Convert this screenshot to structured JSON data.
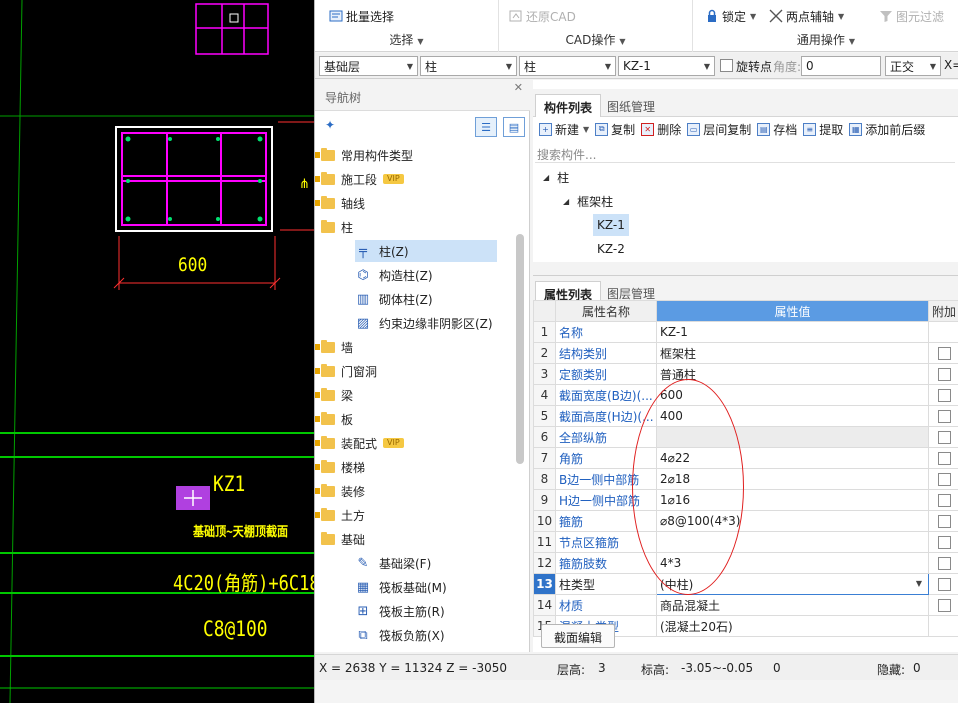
{
  "cad": {
    "dim_label": "600",
    "element_label": "KZ1",
    "note_label": "基础顶~天棚顶截面",
    "rebar_label": "4C20(角筋)+6C18",
    "stirrup_label": "C8@100"
  },
  "ribbon": {
    "groups": [
      {
        "label": "选择",
        "buttons": [
          {
            "label": "批量选择",
            "icon": "batch-select-icon"
          }
        ]
      },
      {
        "label": "CAD操作",
        "buttons": [
          {
            "label": "还原CAD",
            "icon": "restore-cad-icon",
            "disabled": true
          }
        ]
      },
      {
        "label": "通用操作",
        "buttons": [
          {
            "label": "锁定",
            "icon": "lock-icon"
          },
          {
            "label": "两点辅轴",
            "icon": "axis-icon"
          },
          {
            "label": "图元过滤",
            "icon": "filter-icon",
            "disabled": true
          }
        ]
      }
    ]
  },
  "selector": {
    "layer": "基础层",
    "category": "柱",
    "type": "柱",
    "component": "KZ-1",
    "rotate_label": "旋转点",
    "angle_label": "角度:",
    "angle_value": "0",
    "mode": "正交",
    "x_label": "X="
  },
  "nav": {
    "title": "导航树",
    "items": [
      {
        "label": "常用构件类型",
        "vip": false
      },
      {
        "label": "施工段",
        "vip": true
      },
      {
        "label": "轴线",
        "vip": false
      },
      {
        "label": "柱",
        "vip": false
      },
      {
        "label": "柱(Z)"
      },
      {
        "label": "构造柱(Z)"
      },
      {
        "label": "砌体柱(Z)"
      },
      {
        "label": "约束边缘非阴影区(Z)"
      },
      {
        "label": "墙",
        "vip": false
      },
      {
        "label": "门窗洞",
        "vip": false
      },
      {
        "label": "梁",
        "vip": false
      },
      {
        "label": "板",
        "vip": false
      },
      {
        "label": "装配式",
        "vip": true
      },
      {
        "label": "楼梯",
        "vip": false
      },
      {
        "label": "装修",
        "vip": false
      },
      {
        "label": "土方",
        "vip": false
      },
      {
        "label": "基础",
        "vip": false
      },
      {
        "label": "基础梁(F)"
      },
      {
        "label": "筏板基础(M)"
      },
      {
        "label": "筏板主筋(R)"
      },
      {
        "label": "筏板负筋(X)"
      }
    ],
    "vip_badge": "VIP"
  },
  "complist": {
    "tabs": [
      "构件列表",
      "图纸管理"
    ],
    "tools": [
      "新建",
      "复制",
      "删除",
      "层间复制",
      "存档",
      "提取",
      "添加前后缀"
    ],
    "search_placeholder": "搜索构件...",
    "tree": {
      "root": "柱",
      "child": "框架柱",
      "items": [
        "KZ-1",
        "KZ-2"
      ]
    }
  },
  "props": {
    "tabs": [
      "属性列表",
      "图层管理"
    ],
    "headers": {
      "name": "属性名称",
      "value": "属性值",
      "extra": "附加"
    },
    "rows": [
      {
        "idx": "1",
        "name": "名称",
        "value": "KZ-1"
      },
      {
        "idx": "2",
        "name": "结构类别",
        "value": "框架柱"
      },
      {
        "idx": "3",
        "name": "定额类别",
        "value": "普通柱"
      },
      {
        "idx": "4",
        "name": "截面宽度(B边)(...",
        "value": "600"
      },
      {
        "idx": "5",
        "name": "截面高度(H边)(...",
        "value": "400"
      },
      {
        "idx": "6",
        "name": "全部纵筋",
        "value": ""
      },
      {
        "idx": "7",
        "name": "角筋",
        "value": "4⌀22"
      },
      {
        "idx": "8",
        "name": "B边一侧中部筋",
        "value": "2⌀18"
      },
      {
        "idx": "9",
        "name": "H边一侧中部筋",
        "value": "1⌀16"
      },
      {
        "idx": "10",
        "name": "箍筋",
        "value": "⌀8@100(4*3)"
      },
      {
        "idx": "11",
        "name": "节点区箍筋",
        "value": ""
      },
      {
        "idx": "12",
        "name": "箍筋肢数",
        "value": "4*3"
      },
      {
        "idx": "13",
        "name": "柱类型",
        "value": "(中柱)"
      },
      {
        "idx": "14",
        "name": "材质",
        "value": "商品混凝土"
      },
      {
        "idx": "15",
        "name": "混凝土类型",
        "value": "(混凝土20石)"
      }
    ],
    "section_edit_button": "截面编辑"
  },
  "status": {
    "coords": "X = 2638 Y = 11324 Z = -3050",
    "floor_height_label": "层高:",
    "floor_height": "3",
    "elevation_label": "标高:",
    "elevation": "-3.05~-0.05",
    "count": "0",
    "hidden_label": "隐藏:",
    "hidden": "0"
  },
  "colors": {
    "cad_bg": "#000000",
    "cad_green": "#00c800",
    "cad_magenta": "#ff00ff",
    "cad_yellow": "#ffff00",
    "cad_red": "#ff3030",
    "accent_blue": "#2f73c9",
    "annotation_red": "#e02020"
  }
}
